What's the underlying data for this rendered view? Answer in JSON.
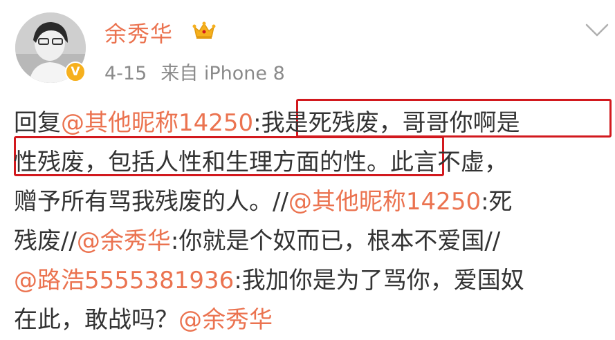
{
  "post": {
    "username": "余秀华",
    "timestamp": "4-15",
    "source": "来自 iPhone 8",
    "verified_badge": "V",
    "colors": {
      "username": "#eb7350",
      "highlight_box": "#d2191e",
      "badge": "#f6b01d"
    }
  },
  "content": {
    "lines": [
      [
        {
          "text": "回复",
          "type": "text"
        },
        {
          "text": "@其他昵称14250",
          "type": "mention"
        },
        {
          "text": ":我是死残废，哥哥你啊是",
          "type": "text"
        }
      ],
      [
        {
          "text": "性残废，包括人性和生理方面的性。此言不虚，",
          "type": "text"
        }
      ],
      [
        {
          "text": "赠予所有骂我残废的人。//",
          "type": "text"
        },
        {
          "text": "@其他昵称14250",
          "type": "mention"
        },
        {
          "text": ":死",
          "type": "text"
        }
      ],
      [
        {
          "text": "残废//",
          "type": "text"
        },
        {
          "text": "@余秀华",
          "type": "mention"
        },
        {
          "text": ":你就是个奴而已，根本不爱国//",
          "type": "text"
        }
      ],
      [
        {
          "text": "@路浩5555381936",
          "type": "mention"
        },
        {
          "text": ":我加你是为了骂你，爱国奴",
          "type": "text"
        }
      ],
      [
        {
          "text": "在此，敢战吗？",
          "type": "text"
        },
        {
          "text": "@余秀华",
          "type": "mention"
        }
      ]
    ]
  },
  "icons": {
    "crown": "crown-icon",
    "chevron": "chevron-down-icon",
    "avatar": "avatar"
  }
}
